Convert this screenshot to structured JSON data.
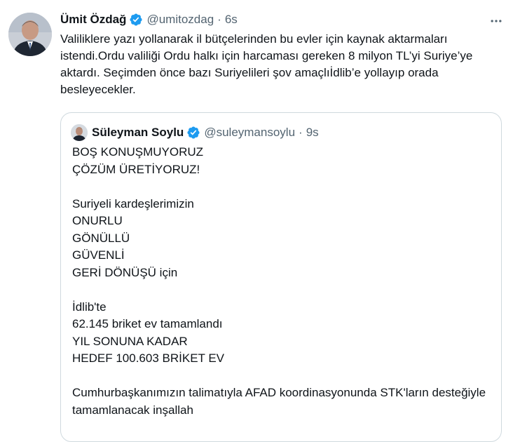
{
  "tweet": {
    "author_name": "Ümit Özdağ",
    "author_handle": "@umitozdag",
    "separator": "·",
    "time": "6s",
    "text": "Valiliklere yazı yollanarak il bütçelerinden bu evler için kaynak aktarmaları istendi.Ordu valiliği Ordu halkı için harcaması gereken 8 milyon TL’yi Suriye’ye aktardı. Seçimden önce bazı Suriyelileri şov amaçlıİdlib’e yollayıp orada besleyecekler."
  },
  "quoted": {
    "author_name": "Süleyman Soylu",
    "author_handle": "@suleymansoylu",
    "separator": "·",
    "time": "9s",
    "text": "BOŞ KONUŞMUYORUZ\nÇÖZÜM ÜRETİYORUZ!\n\nSuriyeli kardeşlerimizin\nONURLU\nGÖNÜLLÜ\nGÜVENLİ\nGERİ DÖNÜŞÜ için\n\nİdlib'te\n62.145 briket ev tamamlandı\nYIL SONUNA KADAR\nHEDEF 100.603 BRİKET EV\n\nCumhurbaşkanımızın talimatıyla AFAD koordinasyonunda STK'ların desteğiyle tamamlanacak inşallah"
  },
  "icons": {
    "verified": "verified-badge-icon",
    "more": "more-options-icon"
  },
  "colors": {
    "verified": "#1d9bf0",
    "secondary_text": "#536471",
    "border": "#cfd9de"
  }
}
